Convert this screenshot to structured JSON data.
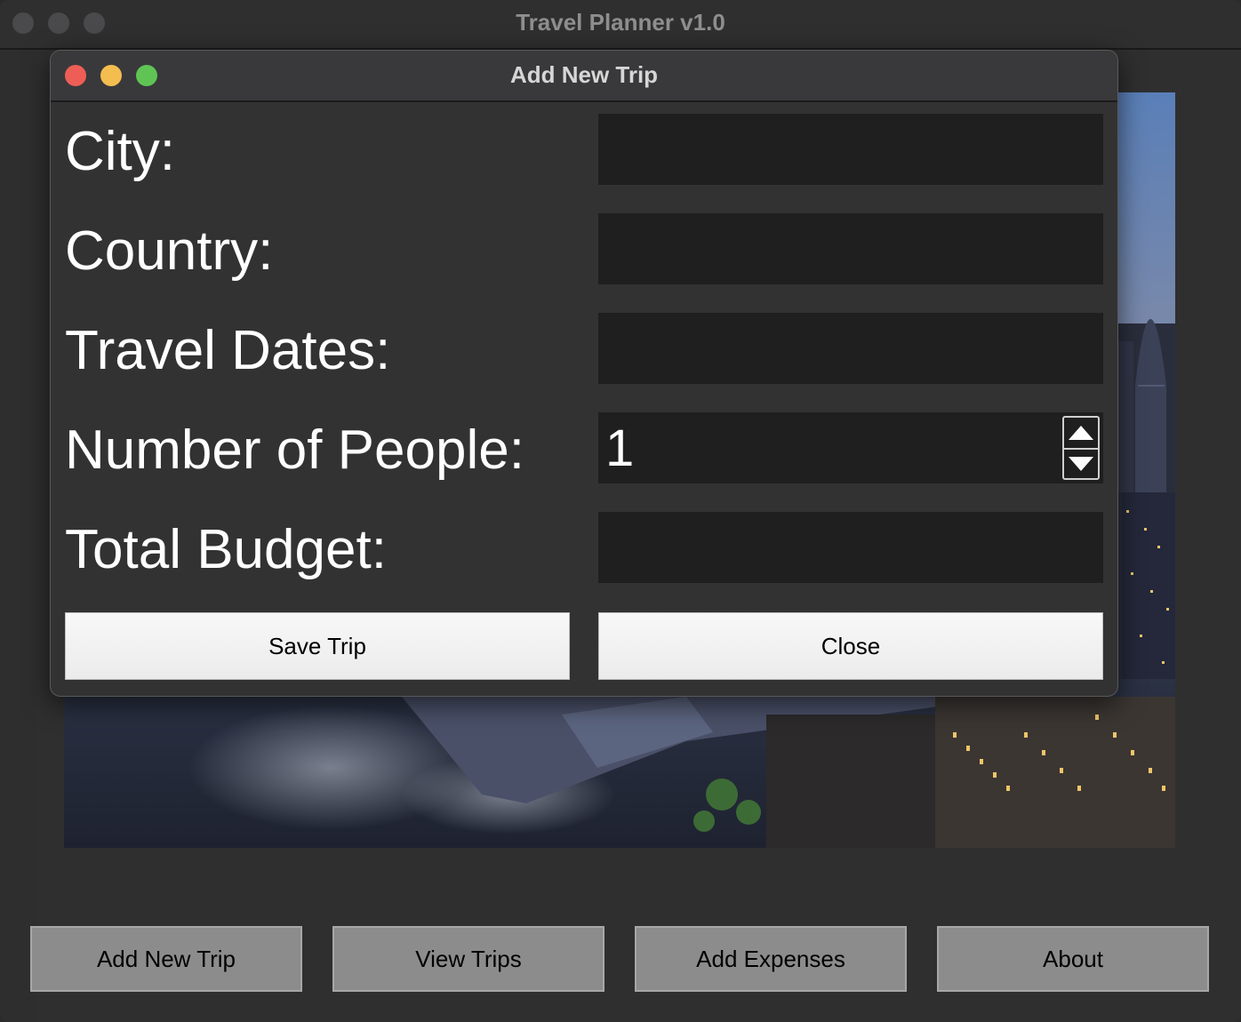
{
  "app": {
    "window_title": "Travel Planner v1.0"
  },
  "dialog": {
    "title": "Add New Trip",
    "fields": {
      "city": {
        "label": "City:",
        "value": ""
      },
      "country": {
        "label": "Country:",
        "value": ""
      },
      "travel_dates": {
        "label": "Travel Dates:",
        "value": ""
      },
      "people": {
        "label": "Number of People:",
        "value": "1"
      },
      "budget": {
        "label": "Total Budget:",
        "value": ""
      }
    },
    "save_label": "Save Trip",
    "close_label": "Close"
  },
  "toolbar": {
    "add_trip_label": "Add New Trip",
    "view_trips_label": "View Trips",
    "add_expenses_label": "Add Expenses",
    "about_label": "About"
  },
  "colors": {
    "close": "#ee5e56",
    "minimize": "#f4bd4f",
    "zoom": "#5fc454",
    "inactive_traffic": "#4a4a4c"
  },
  "icons": {
    "spin_up": "triangle-up-icon",
    "spin_down": "triangle-down-icon",
    "background_image": "london-night-skyline"
  }
}
